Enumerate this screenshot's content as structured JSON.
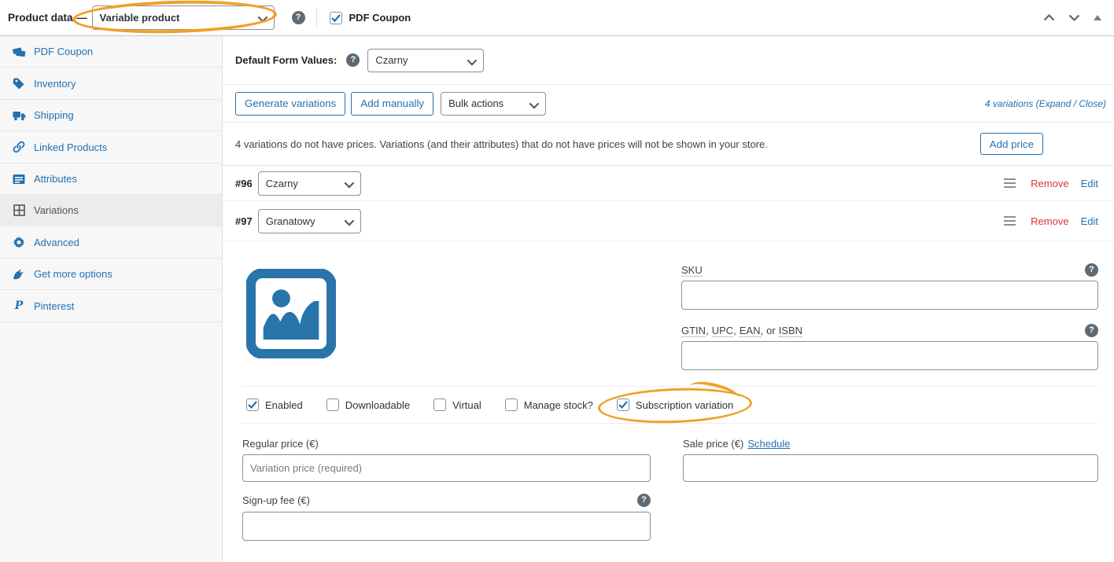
{
  "header": {
    "title": "Product data",
    "dash": "—",
    "product_type": "Variable product",
    "pdf_coupon_label": "PDF Coupon"
  },
  "sidebar": {
    "items": [
      {
        "label": "PDF Coupon",
        "icon": "tickets-icon"
      },
      {
        "label": "Inventory",
        "icon": "tag-icon"
      },
      {
        "label": "Shipping",
        "icon": "truck-icon"
      },
      {
        "label": "Linked Products",
        "icon": "link-icon"
      },
      {
        "label": "Attributes",
        "icon": "card-icon"
      },
      {
        "label": "Variations",
        "icon": "grid-icon"
      },
      {
        "label": "Advanced",
        "icon": "gear-icon"
      },
      {
        "label": "Get more options",
        "icon": "plug-icon"
      },
      {
        "label": "Pinterest",
        "icon": "pinterest-icon"
      }
    ]
  },
  "defaults_row": {
    "label": "Default Form Values:",
    "value": "Czarny"
  },
  "toolbar": {
    "generate_variations": "Generate variations",
    "add_manually": "Add manually",
    "bulk_actions": "Bulk actions",
    "summary_prefix": "4 variations (",
    "expand": "Expand",
    "separator": " / ",
    "close": "Close",
    "summary_suffix": ")"
  },
  "notice": {
    "text": "4 variations do not have prices. Variations (and their attributes) that do not have prices will not be shown in your store.",
    "add_price": "Add price"
  },
  "variations": [
    {
      "id": "#96",
      "value": "Czarny",
      "remove": "Remove",
      "edit": "Edit"
    },
    {
      "id": "#97",
      "value": "Granatowy",
      "remove": "Remove",
      "edit": "Edit"
    }
  ],
  "detail": {
    "sku_label": "SKU",
    "gtin": {
      "w1": "GTIN",
      "w2": "UPC",
      "w3": "EAN",
      "or": "or",
      "w4": "ISBN",
      "comma": ","
    },
    "checkboxes": [
      {
        "label": "Enabled",
        "checked": true
      },
      {
        "label": "Downloadable",
        "checked": false
      },
      {
        "label": "Virtual",
        "checked": false
      },
      {
        "label": "Manage stock?",
        "checked": false
      },
      {
        "label": "Subscription variation",
        "checked": true
      }
    ],
    "regular_price": {
      "label": "Regular price (€)",
      "placeholder": "Variation price (required)"
    },
    "sale_price": {
      "label": "Sale price (€)",
      "schedule": "Schedule"
    },
    "signup_fee": {
      "label": "Sign-up fee (€)"
    }
  },
  "colors": {
    "accent_blue": "#2271b1",
    "remove_red": "#d63638",
    "annotation_orange": "#f0a028",
    "placeholder_blue": "#2874ab"
  }
}
